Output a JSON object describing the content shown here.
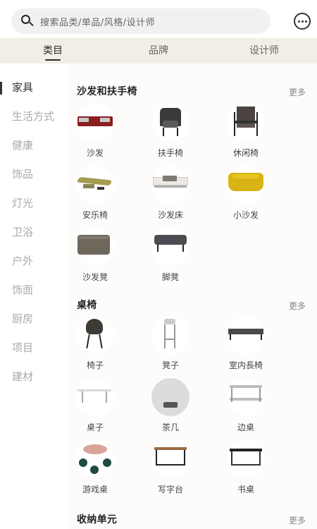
{
  "search": {
    "placeholder": "搜索品类/单品/风格/设计师",
    "icon": "search-icon"
  },
  "header": {
    "message_icon": "message-bubble-icon"
  },
  "tabs": [
    {
      "label": "类目",
      "active": true
    },
    {
      "label": "品牌",
      "active": false
    },
    {
      "label": "设计师",
      "active": false
    }
  ],
  "sidebar": {
    "items": [
      {
        "label": "家具",
        "active": true
      },
      {
        "label": "生活方式",
        "active": false
      },
      {
        "label": "健康",
        "active": false
      },
      {
        "label": "饰品",
        "active": false
      },
      {
        "label": "灯光",
        "active": false
      },
      {
        "label": "卫浴",
        "active": false
      },
      {
        "label": "户外",
        "active": false
      },
      {
        "label": "饰面",
        "active": false
      },
      {
        "label": "厨房",
        "active": false
      },
      {
        "label": "项目",
        "active": false
      },
      {
        "label": "建材",
        "active": false
      }
    ]
  },
  "sections": [
    {
      "title": "沙发和扶手椅",
      "more": "更多",
      "items": [
        "沙发",
        "扶手椅",
        "休闲椅",
        "安乐椅",
        "沙发床",
        "小沙发",
        "沙发凳",
        "脚凳"
      ]
    },
    {
      "title": "桌椅",
      "more": "更多",
      "items": [
        "椅子",
        "凳子",
        "室内長椅",
        "桌子",
        "茶几",
        "边桌",
        "游戏桌",
        "写字台",
        "书桌"
      ]
    },
    {
      "title": "收纳单元",
      "more": "更多",
      "items": []
    }
  ],
  "colors": {
    "tab_bg": "#f3eee5",
    "accent": "#2b2b2b",
    "sofa_red": "#8b1e22",
    "yellow": "#d7b413"
  }
}
